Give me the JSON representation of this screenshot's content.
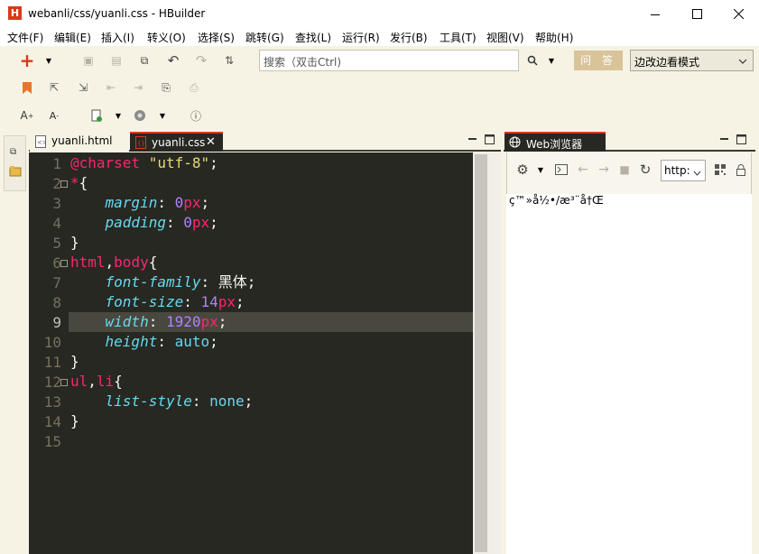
{
  "window": {
    "title": "webanli/css/yuanli.css  -  HBuilder",
    "app_icon": "H"
  },
  "menu": [
    "文件(F)",
    "编辑(E)",
    "插入(I)",
    "转义(O)",
    "选择(S)",
    "跳转(G)",
    "查找(L)",
    "运行(R)",
    "发行(B)",
    "工具(T)",
    "视图(V)",
    "帮助(H)"
  ],
  "toolbar": {
    "search_placeholder": "搜索（双击Ctrl)",
    "ask_label": "问 答",
    "mode": "边改边看模式"
  },
  "editor": {
    "tabs": [
      "yuanli.html",
      "yuanli.css"
    ],
    "active_tab": 1,
    "active_line": 9,
    "lines": [
      [
        [
          "@charset",
          "#f92672"
        ],
        [
          " ",
          "#f8f8f2"
        ],
        [
          "\"utf-8\"",
          "#e6db74"
        ],
        [
          ";",
          "#f8f8f2"
        ]
      ],
      [
        [
          "*",
          "#f92672"
        ],
        [
          "{",
          "#f8f8f2"
        ]
      ],
      [
        [
          "    ",
          "#f8f8f2"
        ],
        [
          "margin",
          "#66d9ef"
        ],
        [
          ": ",
          "#f8f8f2"
        ],
        [
          "0",
          "#ae81ff"
        ],
        [
          "px",
          "#f92672"
        ],
        [
          ";",
          "#f8f8f2"
        ]
      ],
      [
        [
          "    ",
          "#f8f8f2"
        ],
        [
          "padding",
          "#66d9ef"
        ],
        [
          ": ",
          "#f8f8f2"
        ],
        [
          "0",
          "#ae81ff"
        ],
        [
          "px",
          "#f92672"
        ],
        [
          ";",
          "#f8f8f2"
        ]
      ],
      [
        [
          "}",
          "#f8f8f2"
        ]
      ],
      [
        [
          "html",
          "#f92672"
        ],
        [
          ",",
          "#f8f8f2"
        ],
        [
          "body",
          "#f92672"
        ],
        [
          "{",
          "#f8f8f2"
        ]
      ],
      [
        [
          "    ",
          "#f8f8f2"
        ],
        [
          "font-family",
          "#66d9ef"
        ],
        [
          ": ",
          "#f8f8f2"
        ],
        [
          "黑体",
          "#f8f8f2"
        ],
        [
          ";",
          "#f8f8f2"
        ]
      ],
      [
        [
          "    ",
          "#f8f8f2"
        ],
        [
          "font-size",
          "#66d9ef"
        ],
        [
          ": ",
          "#f8f8f2"
        ],
        [
          "14",
          "#ae81ff"
        ],
        [
          "px",
          "#f92672"
        ],
        [
          ";",
          "#f8f8f2"
        ]
      ],
      [
        [
          "    ",
          "#f8f8f2"
        ],
        [
          "width",
          "#66d9ef"
        ],
        [
          ": ",
          "#f8f8f2"
        ],
        [
          "1920",
          "#ae81ff"
        ],
        [
          "px",
          "#f92672"
        ],
        [
          ";",
          "#f8f8f2"
        ]
      ],
      [
        [
          "    ",
          "#f8f8f2"
        ],
        [
          "height",
          "#66d9ef"
        ],
        [
          ": ",
          "#f8f8f2"
        ],
        [
          "auto",
          "#66d9ef"
        ],
        [
          ";",
          "#f8f8f2"
        ]
      ],
      [
        [
          "}",
          "#f8f8f2"
        ]
      ],
      [
        [
          "ul",
          "#f92672"
        ],
        [
          ",",
          "#f8f8f2"
        ],
        [
          "li",
          "#f92672"
        ],
        [
          "{",
          "#f8f8f2"
        ]
      ],
      [
        [
          "    ",
          "#f8f8f2"
        ],
        [
          "list-style",
          "#66d9ef"
        ],
        [
          ": ",
          "#f8f8f2"
        ],
        [
          "none",
          "#66d9ef"
        ],
        [
          ";",
          "#f8f8f2"
        ]
      ],
      [
        [
          "}",
          "#f8f8f2"
        ]
      ],
      []
    ],
    "fold_lines": [
      2,
      6,
      12
    ]
  },
  "browser": {
    "tab_label": "Web浏览器",
    "url": "http:",
    "content": "ç™»å½•/æ³¨å†Œ"
  },
  "colors": {
    "accent": "#d83a1b",
    "editor_bg": "#272822",
    "ask_bg": "#d9c49a"
  }
}
